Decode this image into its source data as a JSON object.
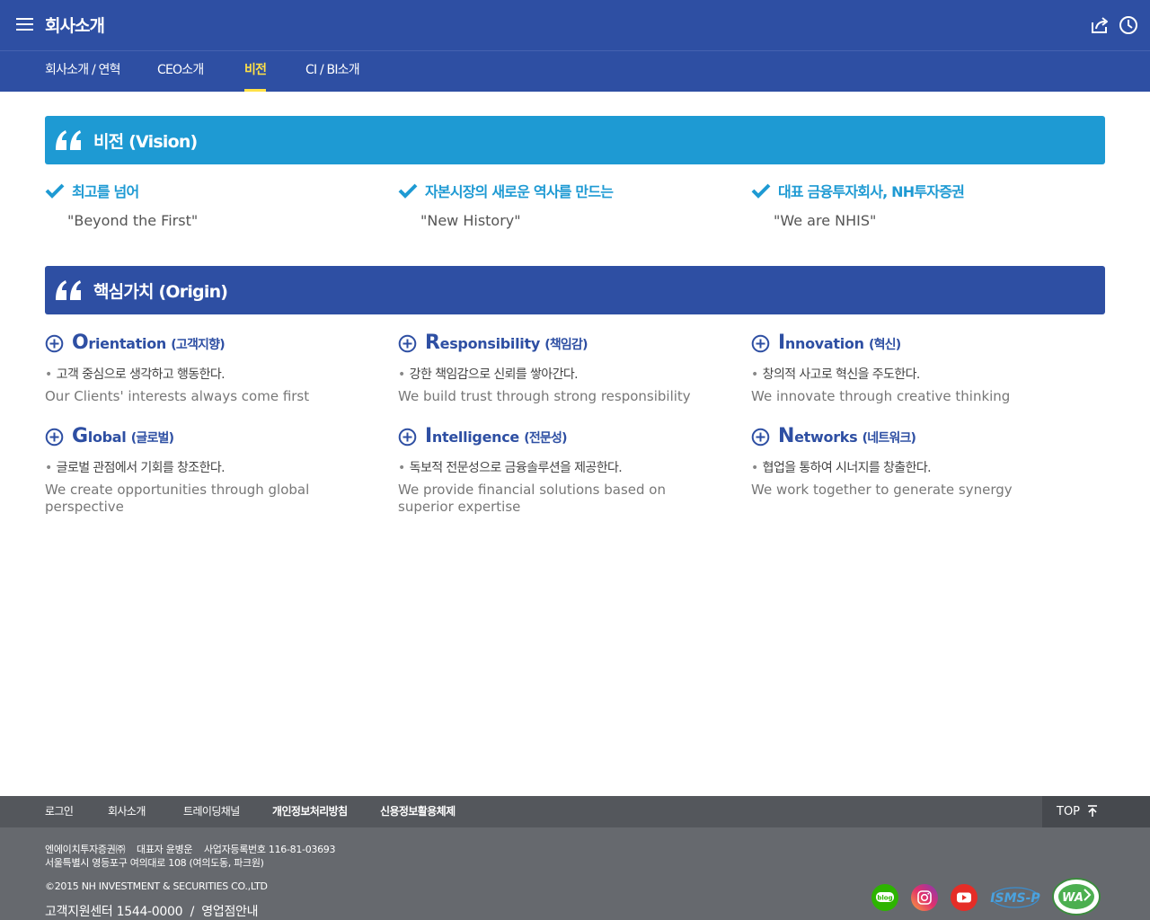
{
  "header": {
    "title": "회사소개",
    "menu_icon": "hamburger-icon",
    "share_icon": "share-icon",
    "history_icon": "clock-icon"
  },
  "tabs": [
    {
      "label": "회사소개 / 연혁",
      "active": false
    },
    {
      "label": "CEO소개",
      "active": false
    },
    {
      "label": "비전",
      "active": true
    },
    {
      "label": "CI / BI소개",
      "active": false
    }
  ],
  "vision": {
    "title": "비전 (Vision)",
    "items": [
      {
        "title": "최고를 넘어",
        "quote": "\"Beyond the First\""
      },
      {
        "title": "자본시장의 새로운 역사를 만드는",
        "quote": "\"New History\""
      },
      {
        "title": "대표 금융투자회사, NH투자증권",
        "quote": "\"We are NHIS\""
      }
    ]
  },
  "origin": {
    "title": "핵심가치 (Origin)",
    "values": [
      {
        "cap": "O",
        "rest": "rientation",
        "ko": "(고객지향)",
        "desc_ko": "고객 중심으로 생각하고 행동한다.",
        "desc_en": "Our Clients' interests always come first"
      },
      {
        "cap": "R",
        "rest": "esponsibility",
        "ko": "(책임감)",
        "desc_ko": "강한 책임감으로 신뢰를 쌓아간다.",
        "desc_en": "We build trust through strong responsibility"
      },
      {
        "cap": "I",
        "rest": "nnovation",
        "ko": "(혁신)",
        "desc_ko": "창의적 사고로 혁신을 주도한다.",
        "desc_en": "We innovate through creative thinking"
      },
      {
        "cap": "G",
        "rest": "lobal",
        "ko": "(글로벌)",
        "desc_ko": "글로벌 관점에서 기회를 창조한다.",
        "desc_en": "We create opportunities through global perspective"
      },
      {
        "cap": "I",
        "rest": "ntelligence",
        "ko": "(전문성)",
        "desc_ko": "독보적 전문성으로 금융솔루션을 제공한다.",
        "desc_en": "We provide financial solutions based on superior expertise"
      },
      {
        "cap": "N",
        "rest": "etworks",
        "ko": "(네트워크)",
        "desc_ko": "협업을 통하여 시너지를 창출한다.",
        "desc_en": "We work together to generate synergy"
      }
    ]
  },
  "footer": {
    "nav": [
      "로그인",
      "회사소개",
      "트레이딩채널",
      "개인정보처리방침",
      "신용정보활용체제"
    ],
    "top_label": "TOP",
    "info_line1": "엔에이치투자증권㈜    대표자 윤병운    사업자등록번호 116-81-03693",
    "info_line2": "서울특별시 영등포구 여의대로 108 (여의도동, 파크원)",
    "copyright": "©2015 NH INVESTMENT & SECURITIES CO.,LTD",
    "support": "고객지원센터 1544-0000",
    "separator": "/",
    "branch": "영업점안내",
    "blog_label": "blog",
    "isms_label": "ISMS-P",
    "wa_label": "WA"
  },
  "colors": {
    "primary": "#2e4fa3",
    "vision_banner": "#1e9ad3",
    "active_tab": "#ffe146",
    "footer_nav": "#54575c",
    "footer_info": "#66696e"
  }
}
